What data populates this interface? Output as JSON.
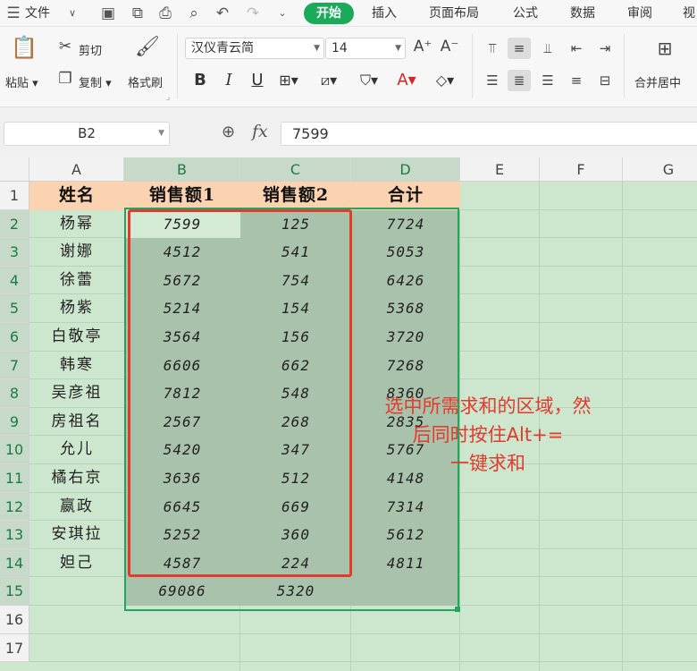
{
  "menubar": {
    "file_label": "文件",
    "tabs": [
      "开始",
      "插入",
      "页面布局",
      "公式",
      "数据",
      "审阅",
      "视"
    ]
  },
  "ribbon": {
    "paste": "粘贴",
    "cut": "剪切",
    "copy": "复制",
    "format_painter": "格式刷",
    "font_name": "汉仪青云简",
    "font_size": "14",
    "merge_center": "合并居中"
  },
  "formula_bar": {
    "name_box": "B2",
    "fx_label": "fx",
    "value": "7599"
  },
  "sheet": {
    "columns": [
      "A",
      "B",
      "C",
      "D",
      "E",
      "F",
      "G"
    ],
    "rows": [
      "1",
      "2",
      "3",
      "4",
      "5",
      "6",
      "7",
      "8",
      "9",
      "10",
      "11",
      "12",
      "13",
      "14",
      "15",
      "16",
      "17"
    ],
    "header": [
      "姓名",
      "销售额1",
      "销售额2",
      "合计"
    ],
    "records": [
      {
        "name": "杨幂",
        "s1": "7599",
        "s2": "125",
        "total": "7724"
      },
      {
        "name": "谢娜",
        "s1": "4512",
        "s2": "541",
        "total": "5053"
      },
      {
        "name": "徐蕾",
        "s1": "5672",
        "s2": "754",
        "total": "6426"
      },
      {
        "name": "杨紫",
        "s1": "5214",
        "s2": "154",
        "total": "5368"
      },
      {
        "name": "白敬亭",
        "s1": "3564",
        "s2": "156",
        "total": "3720"
      },
      {
        "name": "韩寒",
        "s1": "6606",
        "s2": "662",
        "total": "7268"
      },
      {
        "name": "吴彦祖",
        "s1": "7812",
        "s2": "548",
        "total": "8360"
      },
      {
        "name": "房祖名",
        "s1": "2567",
        "s2": "268",
        "total": "2835"
      },
      {
        "name": "允儿",
        "s1": "5420",
        "s2": "347",
        "total": "5767"
      },
      {
        "name": "橘右京",
        "s1": "3636",
        "s2": "512",
        "total": "4148"
      },
      {
        "name": "嬴政",
        "s1": "6645",
        "s2": "669",
        "total": "7314"
      },
      {
        "name": "安琪拉",
        "s1": "5252",
        "s2": "360",
        "total": "5612"
      },
      {
        "name": "妲己",
        "s1": "4587",
        "s2": "224",
        "total": "4811"
      }
    ],
    "totals": {
      "s1": "69086",
      "s2": "5320"
    }
  },
  "annotation": {
    "line1": "选中所需求和的区域，然",
    "line2": "后同时按住Alt+=",
    "line3": "一键求和"
  },
  "colors": {
    "accent_green": "#1aab5a",
    "header_fill": "#fbd3b0",
    "annotation_red": "#e23a2c"
  }
}
